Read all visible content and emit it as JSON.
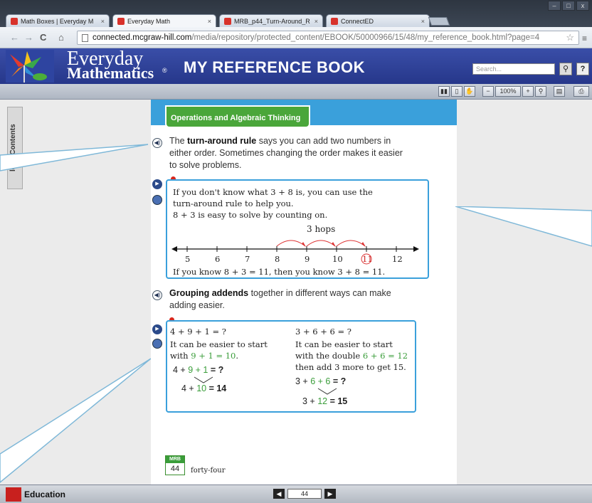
{
  "browser": {
    "tabs": [
      {
        "title": "Math Boxes | Everyday M",
        "active": false
      },
      {
        "title": "Everyday Math",
        "active": true
      },
      {
        "title": "MRB_p44_Turn-Around_R",
        "active": false
      },
      {
        "title": "ConnectED",
        "active": false
      }
    ],
    "url_host": "connected.mcgraw-hill.com",
    "url_path": "/media/repository/protected_content/EBOOK/50000966/15/48/my_reference_book.html?page=4",
    "back_icon": "back-arrow-icon",
    "forward_icon": "forward-arrow-icon",
    "reload_icon": "reload-icon",
    "home_icon": "home-icon",
    "star_icon": "star-icon",
    "menu_icon": "menu-icon"
  },
  "app": {
    "brand_line1": "Everyday",
    "brand_line2": "Mathematics",
    "brand_reg": "®",
    "title": "MY REFERENCE BOOK",
    "search_placeholder": "Search...",
    "help_label": "?",
    "accent_color": "#2b3d95"
  },
  "viewbar": {
    "zoom_label": "100%"
  },
  "sidebar": {
    "toc_label": "le of Contents"
  },
  "page": {
    "section_title": "Operations and Algebraic Thinking",
    "para1_prefix": "The ",
    "para1_bold": "turn-around rule",
    "para1_rest": " says you can add two numbers in either order. Sometimes changing the order makes it easier to solve problems.",
    "box1_text": "If you don't know what 3 + 8 is, you can use the turn-around rule to help you. 8 + 3 is easy to solve by counting on.",
    "box1_line1": "If you don't know what 3 + 8 is, you can use the",
    "box1_line2": "turn-around rule to help you.",
    "box1_line3": "8 + 3 is easy to solve by counting on.",
    "hops_label": "3 hops",
    "number_line": [
      "5",
      "6",
      "7",
      "8",
      "9",
      "10",
      "11",
      "12"
    ],
    "box1_conclusion": "If you know 8 + 3 = 11, then you know 3 + 8 = 11.",
    "para2_bold": "Grouping addends",
    "para2_rest": " together in different ways can make adding easier.",
    "left_eq": "4 + 9 + 1 = ?",
    "left_t1": "It can be easier to start",
    "left_t2_a": "with ",
    "left_t2_b": "9 + 1 = 10",
    "left_t2_c": ".",
    "left_g1_a": "4 + ",
    "left_g1_b": "9 + 1",
    "left_g1_c": " = ?",
    "left_g2_a": "4 + ",
    "left_g2_b": "10",
    "left_g2_c": " = 14",
    "right_eq": "3 + 6 + 6 = ?",
    "right_t1": "It can be easier to start",
    "right_t2_a": "with the double ",
    "right_t2_b": "6 + 6 = 12",
    "right_t3": "then add 3 more to get 15.",
    "right_g1_a": "3 + ",
    "right_g1_b": "6 + 6",
    "right_g1_c": " = ?",
    "right_g2_a": "3 + ",
    "right_g2_b": "12",
    "right_g2_c": " = 15",
    "page_badge_top": "MRB",
    "page_badge_num": "44",
    "page_words": "forty-four"
  },
  "statusbar": {
    "publisher": "Education",
    "page_number": "44"
  }
}
